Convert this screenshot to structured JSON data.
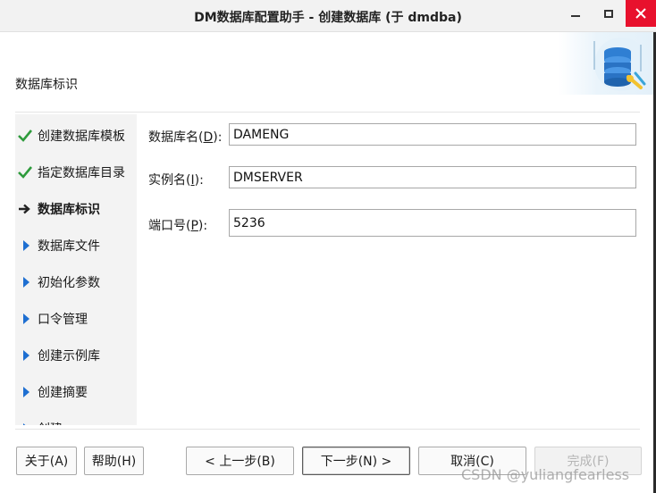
{
  "window": {
    "title": "DM数据库配置助手 - 创建数据库 (于 dmdba)"
  },
  "header": {
    "section_title": "数据库标识"
  },
  "nav": {
    "items": [
      {
        "label": "创建数据库模板",
        "state": "done"
      },
      {
        "label": "指定数据库目录",
        "state": "done"
      },
      {
        "label": "数据库标识",
        "state": "current"
      },
      {
        "label": "数据库文件",
        "state": "pending"
      },
      {
        "label": "初始化参数",
        "state": "pending"
      },
      {
        "label": "口令管理",
        "state": "pending"
      },
      {
        "label": "创建示例库",
        "state": "pending"
      },
      {
        "label": "创建摘要",
        "state": "pending"
      },
      {
        "label": "创建",
        "state": "pending"
      }
    ]
  },
  "form": {
    "db_name": {
      "label_pre": "数据库名(",
      "accel": "D",
      "label_post": "):",
      "value": "DAMENG"
    },
    "instance_name": {
      "label_pre": "实例名(",
      "accel": "I",
      "label_post": "):",
      "value": "DMSERVER"
    },
    "port": {
      "label_pre": "端口号(",
      "accel": "P",
      "label_post": "):",
      "value": "5236"
    }
  },
  "buttons": {
    "about": "关于(A)",
    "help": "帮助(H)",
    "prev": "< 上一步(B)",
    "next": "下一步(N) >",
    "cancel": "取消(C)",
    "finish": "完成(F)"
  },
  "watermark": "CSDN @yuliangfearless",
  "colors": {
    "check": "#2e9b3c",
    "current_arrow": "#222222",
    "pending_triangle": "#1e6fd1",
    "close_button": "#e8112d"
  },
  "icons": {
    "done": "check-icon",
    "current": "arrow-right-icon",
    "pending": "triangle-right-icon",
    "header": "database-icon"
  }
}
